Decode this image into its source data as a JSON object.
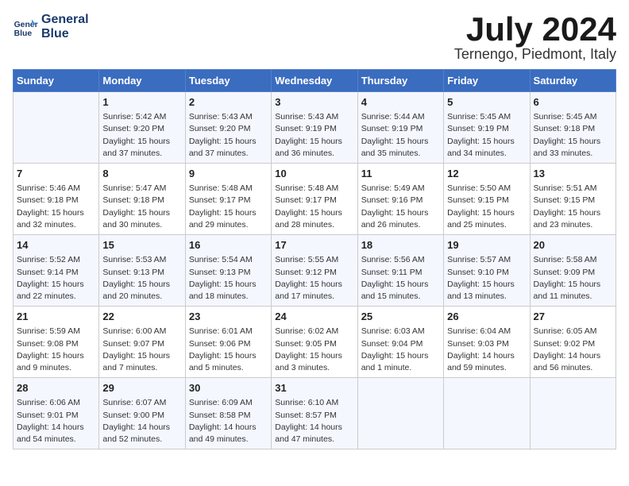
{
  "logo": {
    "line1": "General",
    "line2": "Blue"
  },
  "title": "July 2024",
  "location": "Ternengo, Piedmont, Italy",
  "weekdays": [
    "Sunday",
    "Monday",
    "Tuesday",
    "Wednesday",
    "Thursday",
    "Friday",
    "Saturday"
  ],
  "weeks": [
    [
      {
        "day": "",
        "info": ""
      },
      {
        "day": "1",
        "info": "Sunrise: 5:42 AM\nSunset: 9:20 PM\nDaylight: 15 hours\nand 37 minutes."
      },
      {
        "day": "2",
        "info": "Sunrise: 5:43 AM\nSunset: 9:20 PM\nDaylight: 15 hours\nand 37 minutes."
      },
      {
        "day": "3",
        "info": "Sunrise: 5:43 AM\nSunset: 9:19 PM\nDaylight: 15 hours\nand 36 minutes."
      },
      {
        "day": "4",
        "info": "Sunrise: 5:44 AM\nSunset: 9:19 PM\nDaylight: 15 hours\nand 35 minutes."
      },
      {
        "day": "5",
        "info": "Sunrise: 5:45 AM\nSunset: 9:19 PM\nDaylight: 15 hours\nand 34 minutes."
      },
      {
        "day": "6",
        "info": "Sunrise: 5:45 AM\nSunset: 9:18 PM\nDaylight: 15 hours\nand 33 minutes."
      }
    ],
    [
      {
        "day": "7",
        "info": "Sunrise: 5:46 AM\nSunset: 9:18 PM\nDaylight: 15 hours\nand 32 minutes."
      },
      {
        "day": "8",
        "info": "Sunrise: 5:47 AM\nSunset: 9:18 PM\nDaylight: 15 hours\nand 30 minutes."
      },
      {
        "day": "9",
        "info": "Sunrise: 5:48 AM\nSunset: 9:17 PM\nDaylight: 15 hours\nand 29 minutes."
      },
      {
        "day": "10",
        "info": "Sunrise: 5:48 AM\nSunset: 9:17 PM\nDaylight: 15 hours\nand 28 minutes."
      },
      {
        "day": "11",
        "info": "Sunrise: 5:49 AM\nSunset: 9:16 PM\nDaylight: 15 hours\nand 26 minutes."
      },
      {
        "day": "12",
        "info": "Sunrise: 5:50 AM\nSunset: 9:15 PM\nDaylight: 15 hours\nand 25 minutes."
      },
      {
        "day": "13",
        "info": "Sunrise: 5:51 AM\nSunset: 9:15 PM\nDaylight: 15 hours\nand 23 minutes."
      }
    ],
    [
      {
        "day": "14",
        "info": "Sunrise: 5:52 AM\nSunset: 9:14 PM\nDaylight: 15 hours\nand 22 minutes."
      },
      {
        "day": "15",
        "info": "Sunrise: 5:53 AM\nSunset: 9:13 PM\nDaylight: 15 hours\nand 20 minutes."
      },
      {
        "day": "16",
        "info": "Sunrise: 5:54 AM\nSunset: 9:13 PM\nDaylight: 15 hours\nand 18 minutes."
      },
      {
        "day": "17",
        "info": "Sunrise: 5:55 AM\nSunset: 9:12 PM\nDaylight: 15 hours\nand 17 minutes."
      },
      {
        "day": "18",
        "info": "Sunrise: 5:56 AM\nSunset: 9:11 PM\nDaylight: 15 hours\nand 15 minutes."
      },
      {
        "day": "19",
        "info": "Sunrise: 5:57 AM\nSunset: 9:10 PM\nDaylight: 15 hours\nand 13 minutes."
      },
      {
        "day": "20",
        "info": "Sunrise: 5:58 AM\nSunset: 9:09 PM\nDaylight: 15 hours\nand 11 minutes."
      }
    ],
    [
      {
        "day": "21",
        "info": "Sunrise: 5:59 AM\nSunset: 9:08 PM\nDaylight: 15 hours\nand 9 minutes."
      },
      {
        "day": "22",
        "info": "Sunrise: 6:00 AM\nSunset: 9:07 PM\nDaylight: 15 hours\nand 7 minutes."
      },
      {
        "day": "23",
        "info": "Sunrise: 6:01 AM\nSunset: 9:06 PM\nDaylight: 15 hours\nand 5 minutes."
      },
      {
        "day": "24",
        "info": "Sunrise: 6:02 AM\nSunset: 9:05 PM\nDaylight: 15 hours\nand 3 minutes."
      },
      {
        "day": "25",
        "info": "Sunrise: 6:03 AM\nSunset: 9:04 PM\nDaylight: 15 hours\nand 1 minute."
      },
      {
        "day": "26",
        "info": "Sunrise: 6:04 AM\nSunset: 9:03 PM\nDaylight: 14 hours\nand 59 minutes."
      },
      {
        "day": "27",
        "info": "Sunrise: 6:05 AM\nSunset: 9:02 PM\nDaylight: 14 hours\nand 56 minutes."
      }
    ],
    [
      {
        "day": "28",
        "info": "Sunrise: 6:06 AM\nSunset: 9:01 PM\nDaylight: 14 hours\nand 54 minutes."
      },
      {
        "day": "29",
        "info": "Sunrise: 6:07 AM\nSunset: 9:00 PM\nDaylight: 14 hours\nand 52 minutes."
      },
      {
        "day": "30",
        "info": "Sunrise: 6:09 AM\nSunset: 8:58 PM\nDaylight: 14 hours\nand 49 minutes."
      },
      {
        "day": "31",
        "info": "Sunrise: 6:10 AM\nSunset: 8:57 PM\nDaylight: 14 hours\nand 47 minutes."
      },
      {
        "day": "",
        "info": ""
      },
      {
        "day": "",
        "info": ""
      },
      {
        "day": "",
        "info": ""
      }
    ]
  ]
}
